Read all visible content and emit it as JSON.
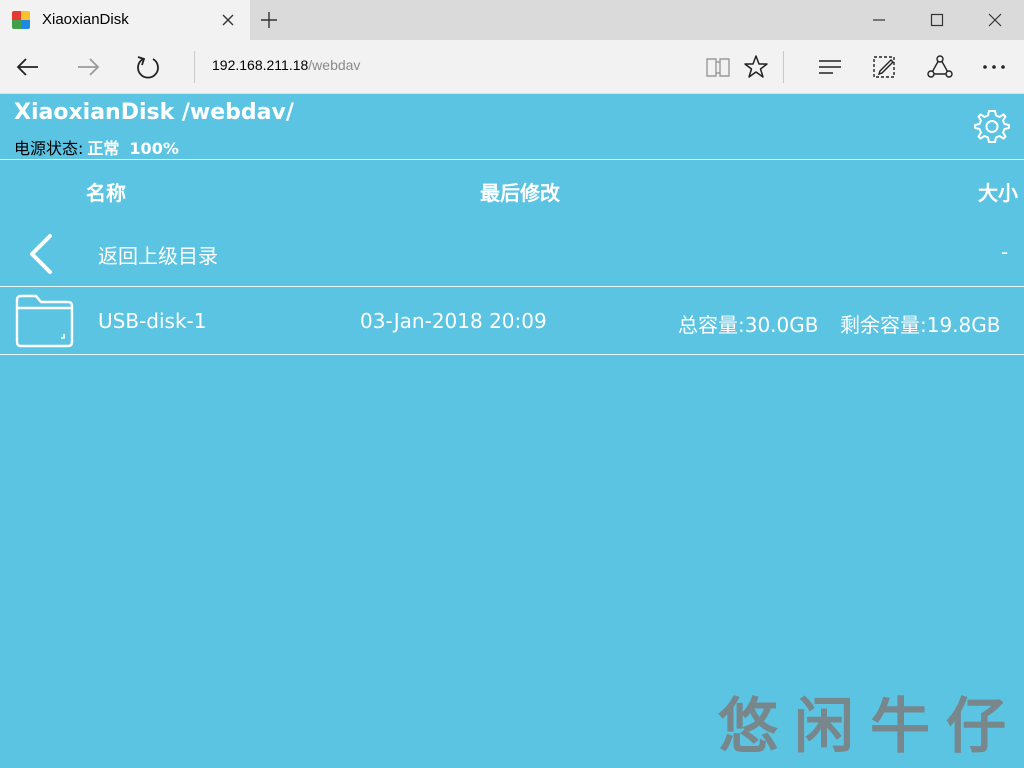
{
  "browser": {
    "tab_title": "XiaoxianDisk",
    "address_host": "192.168.211.18",
    "address_path": "/webdav"
  },
  "header": {
    "title": "XiaoxianDisk /webdav/",
    "power_label": "电源状态:",
    "power_status": "正常",
    "power_percent": "100%"
  },
  "table": {
    "columns": {
      "name": "名称",
      "modified": "最后修改",
      "size": "大小"
    },
    "parent_row": {
      "name": "返回上级目录",
      "size": "-"
    },
    "rows": [
      {
        "name": "USB-disk-1",
        "modified": "03-Jan-2018 20:09",
        "total": "总容量:30.0GB",
        "free": "剩余容量:19.8GB"
      }
    ]
  },
  "watermark": "悠闲牛仔",
  "colors": {
    "page_bg": "#5bc4e3",
    "chrome_bg": "#f2f2f2"
  },
  "icons": [
    "favicon",
    "close-icon",
    "plus-icon",
    "minimize-icon",
    "maximize-icon",
    "back-icon",
    "forward-icon",
    "refresh-icon",
    "reading-view-icon",
    "favorite-star-icon",
    "hub-icon",
    "web-note-icon",
    "share-icon",
    "more-icon",
    "gear-icon",
    "chevron-left-icon",
    "folder-icon"
  ]
}
